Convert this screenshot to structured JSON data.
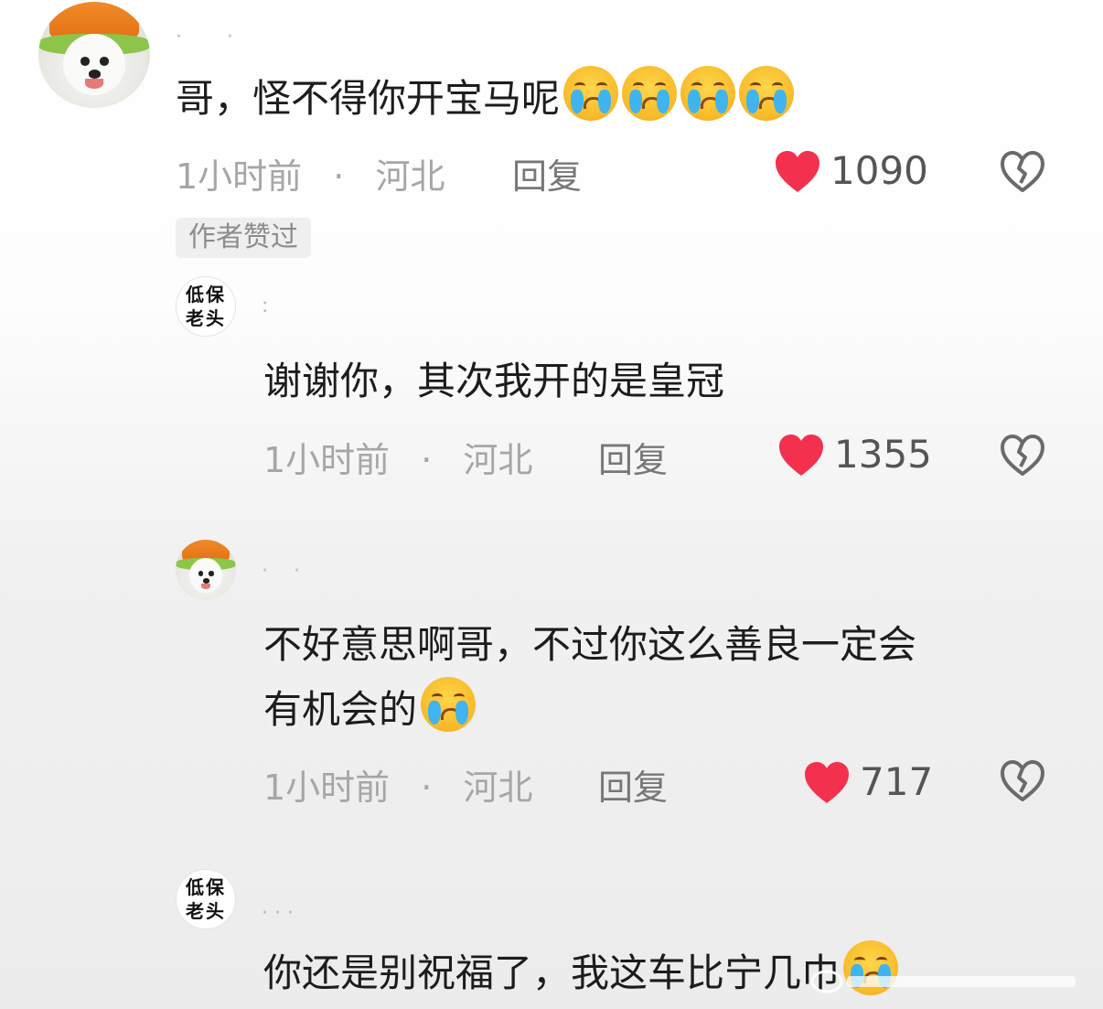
{
  "comments": [
    {
      "avatar": "samoyed-hat-avatar",
      "text": "哥，怪不得你开宝马呢",
      "emoji_count": 4,
      "emoji": "crying-face-emoji",
      "time": "1小时前",
      "dot": "·",
      "location": "河北",
      "reply": "回复",
      "likes": "1090",
      "badge": "作者赞过"
    },
    {
      "avatar_text": "低保\n老头",
      "text": "谢谢你，其次我开的是皇冠",
      "time": "1小时前",
      "dot": "·",
      "location": "河北",
      "reply": "回复",
      "likes": "1355"
    },
    {
      "avatar": "samoyed-hat-avatar",
      "text_line1": "不好意思啊哥，不过你这么善良一定会",
      "text_line2": "有机会的",
      "emoji": "crying-face-emoji",
      "time": "1小时前",
      "dot": "·",
      "location": "河北",
      "reply": "回复",
      "likes": "717"
    },
    {
      "avatar_text": "低保\n老头",
      "text": "你还是别祝福了，我这车比宁几巾"
    }
  ],
  "colors": {
    "heart": "#f4304f",
    "meta": "#a6a6a6",
    "text": "#1c1c1c"
  }
}
